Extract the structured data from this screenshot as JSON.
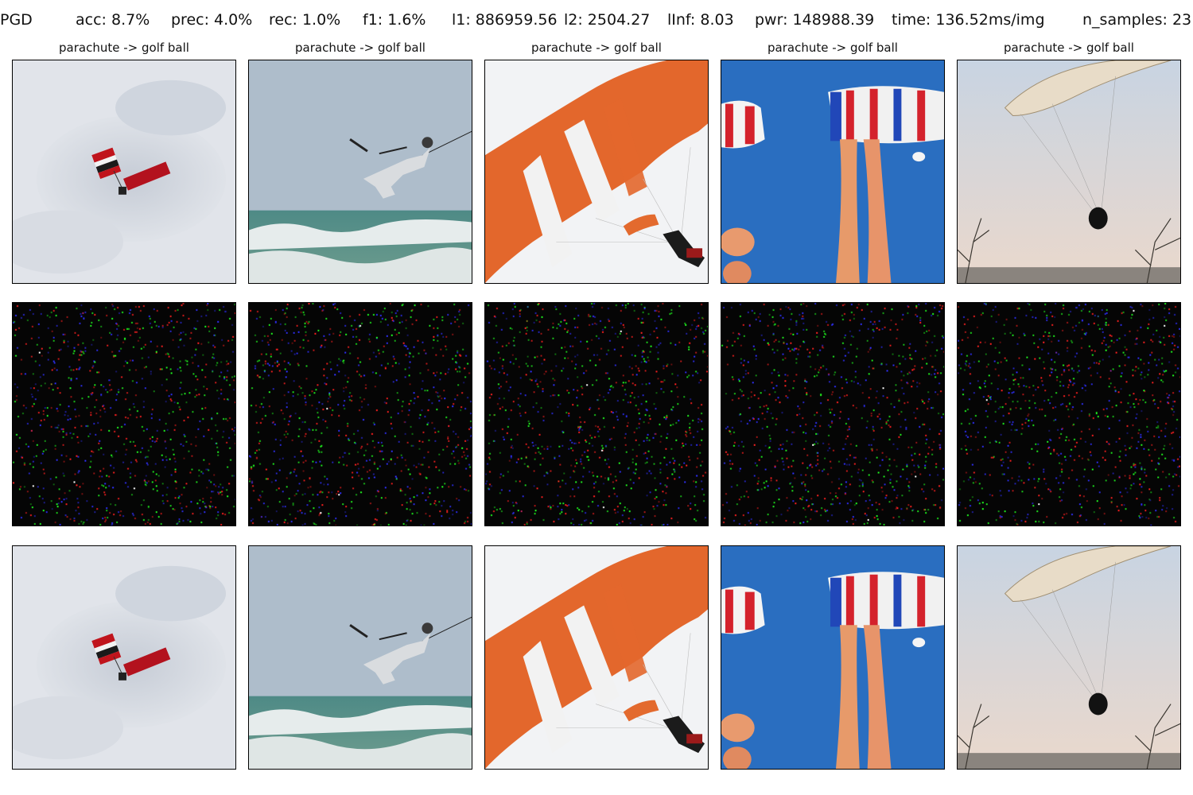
{
  "header": {
    "method": "PGD",
    "acc": "acc: 8.7%",
    "prec": "prec: 4.0%",
    "rec": "rec: 1.0%",
    "f1": "f1: 1.6%",
    "l1": "l1: 886959.56",
    "l2": "l2: 2504.27",
    "linf": "lInf: 8.03",
    "pwr": "pwr: 148988.39",
    "time": "time: 136.52ms/img",
    "n_samples": "n_samples: 23"
  },
  "columns": [
    {
      "title": "parachute -> golf ball",
      "scene": "skydiver-in-clouds"
    },
    {
      "title": "parachute -> golf ball",
      "scene": "kitesurfer-over-waves"
    },
    {
      "title": "parachute -> golf ball",
      "scene": "orange-white-parachute"
    },
    {
      "title": "parachute -> golf ball",
      "scene": "raf-parachutes-smoke"
    },
    {
      "title": "parachute -> golf ball",
      "scene": "paraglider-at-dusk"
    }
  ],
  "rows": [
    "original",
    "perturbation",
    "adversarial"
  ],
  "colors": {
    "background": "#ffffff",
    "noise_background": "#050505",
    "noise_dot_colors": [
      "#ff2020",
      "#20ff20",
      "#3030ff",
      "#ffffff"
    ]
  }
}
